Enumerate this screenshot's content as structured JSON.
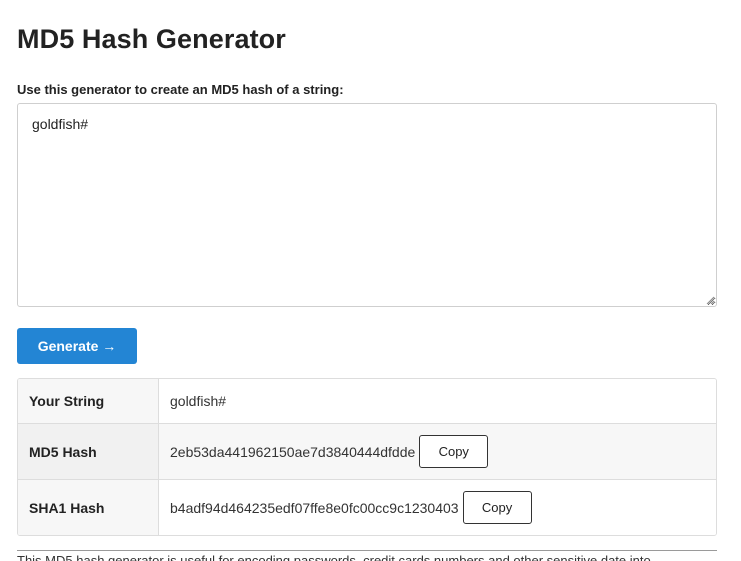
{
  "page": {
    "title": "MD5 Hash Generator",
    "prompt": "Use this generator to create an MD5 hash of a string:"
  },
  "input": {
    "value": "goldfish#"
  },
  "generate_button": {
    "label": "Generate →",
    "color": "#2385d4"
  },
  "results": {
    "rows": [
      {
        "label": "Your String",
        "value": "goldfish#"
      },
      {
        "label": "MD5 Hash",
        "value": "2eb53da441962150ae7d3840444dfdde",
        "copy_label": "Copy"
      },
      {
        "label": "SHA1 Hash",
        "value": "b4adf94d464235edf07ffe8e0fc00cc9c1230403",
        "copy_label": "Copy"
      }
    ]
  },
  "footer": {
    "text": "This MD5 hash generator is useful for encoding passwords, credit cards numbers and other sensitive date into"
  }
}
